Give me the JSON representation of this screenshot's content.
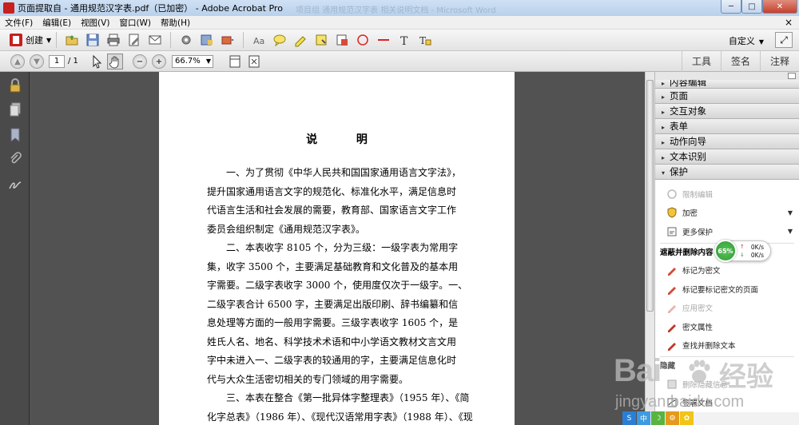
{
  "window": {
    "title": "页面提取自 - 通用规范汉字表.pdf（已加密） - Adobe Acrobat Pro",
    "faded_title": "项目组 通用规范汉字表 相关说明文档 - Microsoft Word",
    "minimize": "─",
    "maximize": "□",
    "close": "✕"
  },
  "menu": {
    "items": [
      "文件(F)",
      "编辑(E)",
      "视图(V)",
      "窗口(W)",
      "帮助(H)"
    ],
    "close_doc": "×"
  },
  "toolbar": {
    "create_label": "创建",
    "customize_label": "自定义",
    "icons": [
      "open-folder-icon",
      "save-icon",
      "print-icon",
      "edit-document-icon",
      "email-icon",
      "settings-icon",
      "save-as-icon",
      "stamp-icon",
      "text-edit-icon",
      "comment-icon",
      "highlight-icon",
      "attach-note-icon",
      "stamp-tool-icon",
      "circle-icon",
      "line-icon",
      "text-tool-icon",
      "text-box-icon"
    ]
  },
  "navbar": {
    "page_number": "1",
    "page_total": "/ 1",
    "zoom": "66.7%",
    "tabs": [
      "工具",
      "签名",
      "注释"
    ]
  },
  "document": {
    "title": "说 明",
    "paragraphs": [
      [
        "一、为了贯彻《中华人民共和国国家通用语言文字法》，",
        "提升国家通用语言文字的规范化、标准化水平，满足信息时",
        "代语言生活和社会发展的需要，教育部、国家语言文字工作",
        "委员会组织制定《通用规范汉字表》。"
      ],
      [
        "二、本表收字 8105 个，分为三级：一级字表为常用字",
        "集，收字 3500 个，主要满足基础教育和文化普及的基本用",
        "字需要。二级字表收字 3000 个，使用度仅次于一级字。一、",
        "二级字表合计 6500 字，主要满足出版印刷、辞书编纂和信",
        "息处理等方面的一般用字需要。三级字表收字 1605 个，是",
        "姓氏人名、地名、科学技术术语和中小学语文教材文言文用",
        "字中未进入一、二级字表的较通用的字，主要满足信息化时",
        "代与大众生活密切相关的专门领域的用字需要。"
      ],
      [
        "三、本表在整合《第一批异体字整理表》（1955 年）、《简",
        "化字总表》（1986 年）、《现代汉语常用字表》（1988 年）、《现"
      ]
    ]
  },
  "task_pane": {
    "cut_section": "内容编辑",
    "sections": [
      "页面",
      "交互对象",
      "表单",
      "动作向导",
      "文本识别",
      "保护"
    ],
    "protect_items": [
      {
        "label": "限制编辑",
        "enabled": false
      },
      {
        "label": "加密",
        "enabled": true
      },
      {
        "label": "更多保护",
        "enabled": true
      }
    ],
    "redact_heading": "遮蔽并删除内容",
    "redact_items": [
      {
        "label": "标记为密文",
        "enabled": true
      },
      {
        "label": "标记要标记密文的页面",
        "enabled": true
      },
      {
        "label": "应用密文",
        "enabled": false
      },
      {
        "label": "密文属性",
        "enabled": true
      },
      {
        "label": "查找并删除文本",
        "enabled": true
      }
    ],
    "bottom_heading": "隐藏",
    "bottom_items": [
      {
        "label": "删除隐藏信息",
        "enabled": false
      },
      {
        "label": "签署文档",
        "enabled": true
      }
    ]
  },
  "net_widget": {
    "percent": "65%",
    "up_speed": "0K/s",
    "down_speed": "0K/s"
  },
  "watermark": {
    "brand": "Bai",
    "brand2": "经验",
    "url": "jingyan.baidu.com"
  },
  "ime": [
    "S",
    "中",
    "☽",
    "⚙",
    "✿"
  ],
  "colors": {
    "acrobat_red": "#c8201e",
    "doc_background": "#525252",
    "nav_panel": "#4a4a4a"
  }
}
